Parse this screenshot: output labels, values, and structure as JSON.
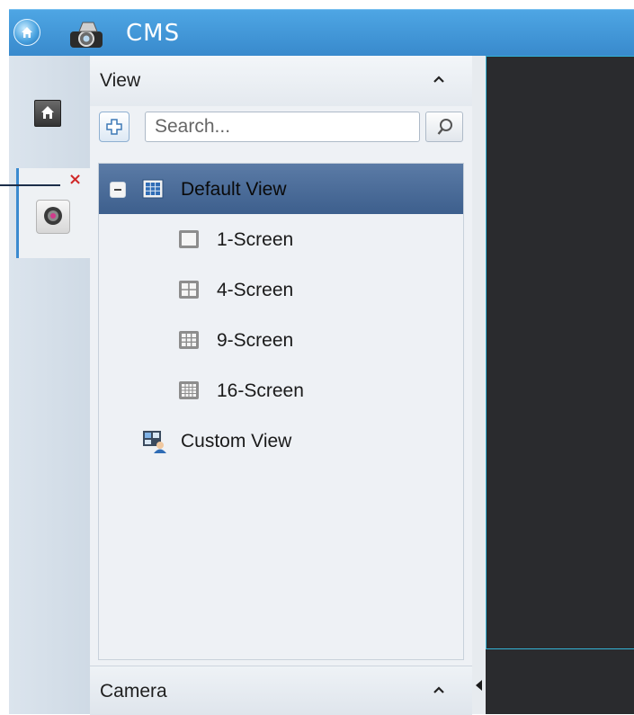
{
  "app": {
    "title": "CMS"
  },
  "sidebar": {
    "home_icon": "home-icon",
    "camera_tab_icon": "camera-icon",
    "close_label": "×"
  },
  "view_panel": {
    "title": "View",
    "search": {
      "placeholder": "Search...",
      "value": ""
    },
    "tree": {
      "default_view": {
        "label": "Default View",
        "expanded": true,
        "selected": true,
        "children": [
          {
            "label": "1-Screen",
            "icon": "screen-1-icon"
          },
          {
            "label": "4-Screen",
            "icon": "screen-4-icon"
          },
          {
            "label": "9-Screen",
            "icon": "screen-9-icon"
          },
          {
            "label": "16-Screen",
            "icon": "screen-16-icon"
          }
        ]
      },
      "custom_view": {
        "label": "Custom View",
        "icon": "custom-view-icon"
      }
    }
  },
  "camera_panel": {
    "title": "Camera"
  },
  "colors": {
    "titlebar": "#3d8fd2",
    "selected_row": "#4a6d9c",
    "video_border": "#34b3d6",
    "video_bg": "#2a2b2e"
  }
}
